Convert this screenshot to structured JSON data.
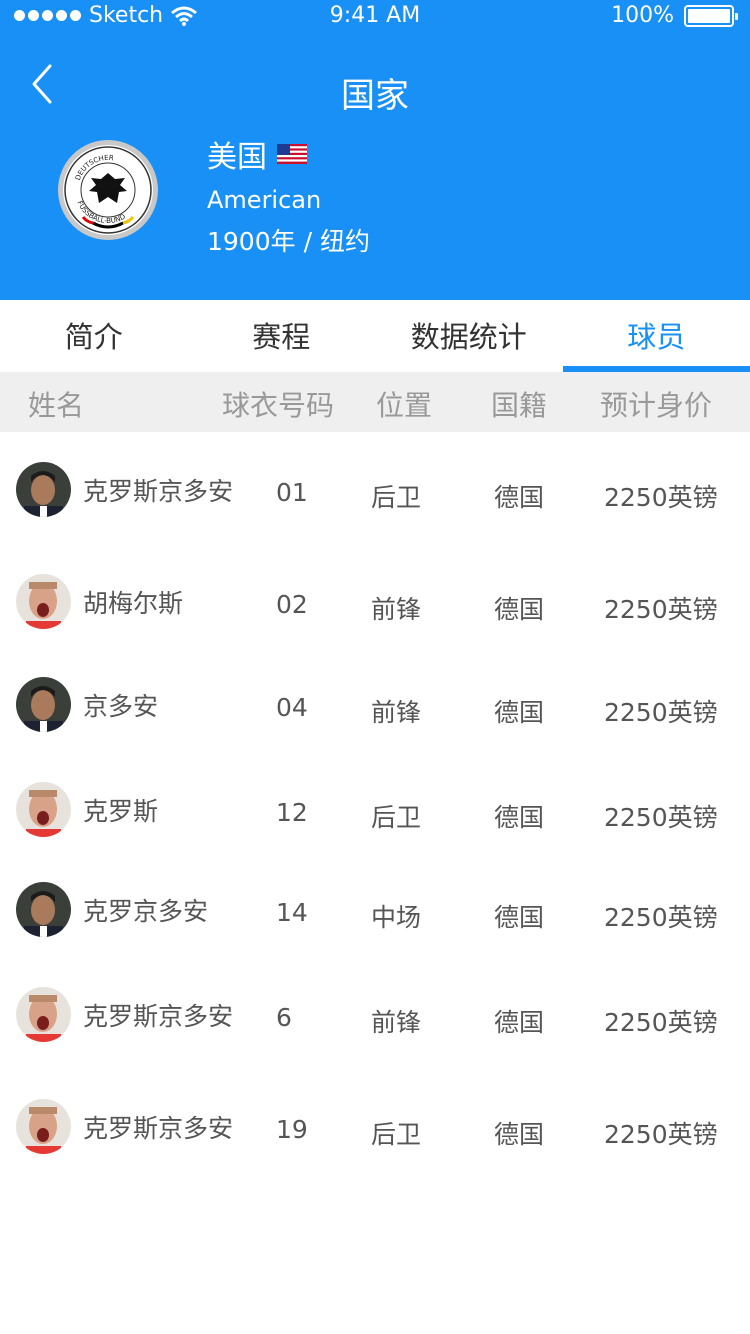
{
  "status_bar": {
    "carrier": "Sketch",
    "time": "9:41 AM",
    "battery": "100%"
  },
  "header": {
    "title": "国家",
    "country_name": "美国",
    "country_english": "American",
    "founded": "1900年 / 纽约",
    "crest_text": "DEUTSCHER FUSSBALL-BUND"
  },
  "tabs": [
    {
      "label": "简介"
    },
    {
      "label": "赛程"
    },
    {
      "label": "数据统计"
    },
    {
      "label": "球员"
    }
  ],
  "table": {
    "columns": [
      "姓名",
      "球衣号码",
      "位置",
      "国籍",
      "预计身价"
    ],
    "rows": [
      {
        "name": "克罗斯京多安",
        "number": "01",
        "position": "后卫",
        "nationality": "德国",
        "value": "2250英镑",
        "avatar": "dark-haired-player-icon"
      },
      {
        "name": "胡梅尔斯",
        "number": "02",
        "position": "前锋",
        "nationality": "德国",
        "value": "2250英镑",
        "avatar": "shouting-player-icon"
      },
      {
        "name": "京多安",
        "number": "04",
        "position": "前锋",
        "nationality": "德国",
        "value": "2250英镑",
        "avatar": "dark-haired-player-icon"
      },
      {
        "name": "克罗斯",
        "number": "12",
        "position": "后卫",
        "nationality": "德国",
        "value": "2250英镑",
        "avatar": "shouting-player-icon"
      },
      {
        "name": "克罗京多安",
        "number": "14",
        "position": "中场",
        "nationality": "德国",
        "value": "2250英镑",
        "avatar": "dark-haired-player-icon"
      },
      {
        "name": "克罗斯京多安",
        "number": "6",
        "position": "前锋",
        "nationality": "德国",
        "value": "2250英镑",
        "avatar": "shouting-player-icon"
      },
      {
        "name": "克罗斯京多安",
        "number": "19",
        "position": "后卫",
        "nationality": "德国",
        "value": "2250英镑",
        "avatar": "shouting-player-icon"
      }
    ]
  },
  "colors": {
    "primary": "#1890f5",
    "header_bg": "#1890f5",
    "table_header_bg": "#efefef"
  }
}
